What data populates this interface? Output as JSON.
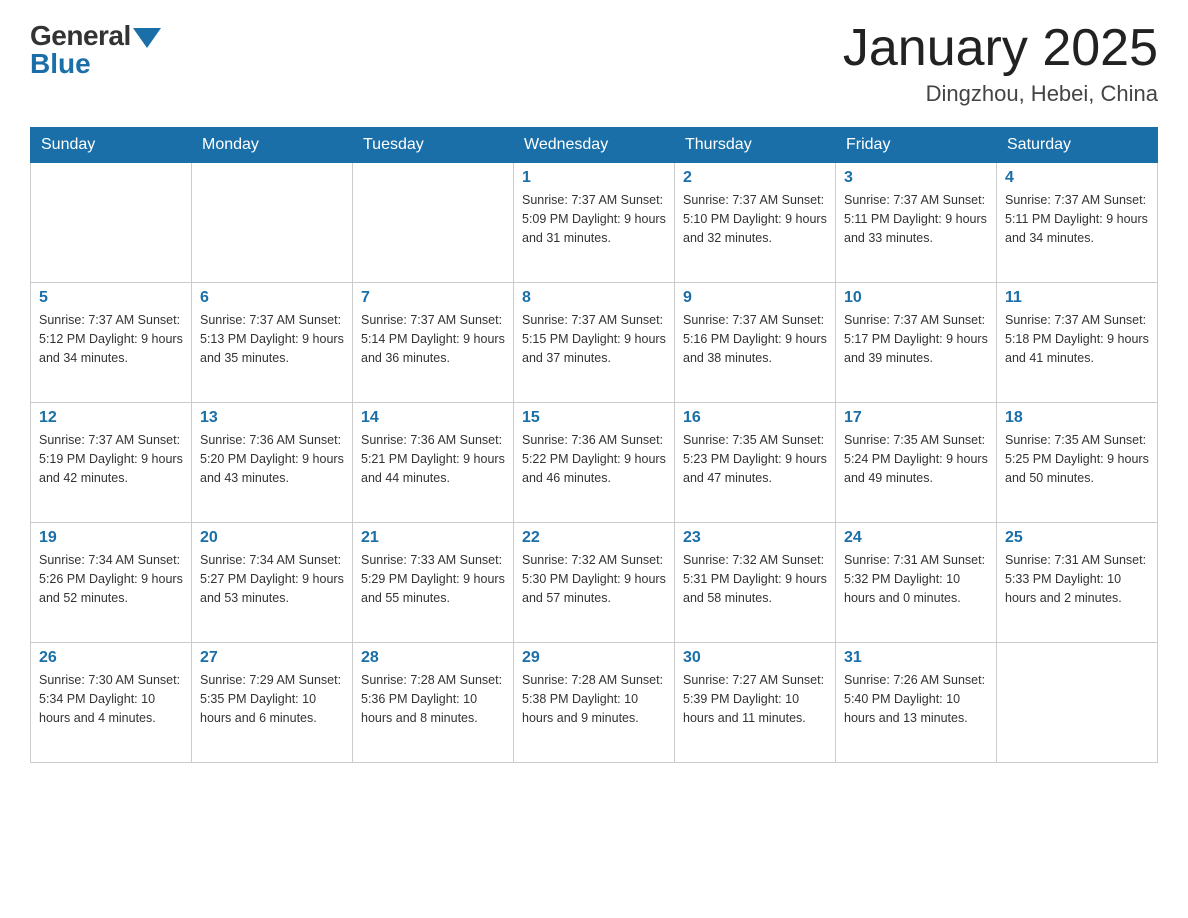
{
  "header": {
    "logo_general": "General",
    "logo_blue": "Blue",
    "month_year": "January 2025",
    "location": "Dingzhou, Hebei, China"
  },
  "days_of_week": [
    "Sunday",
    "Monday",
    "Tuesday",
    "Wednesday",
    "Thursday",
    "Friday",
    "Saturday"
  ],
  "weeks": [
    [
      {
        "day": "",
        "info": ""
      },
      {
        "day": "",
        "info": ""
      },
      {
        "day": "",
        "info": ""
      },
      {
        "day": "1",
        "info": "Sunrise: 7:37 AM\nSunset: 5:09 PM\nDaylight: 9 hours\nand 31 minutes."
      },
      {
        "day": "2",
        "info": "Sunrise: 7:37 AM\nSunset: 5:10 PM\nDaylight: 9 hours\nand 32 minutes."
      },
      {
        "day": "3",
        "info": "Sunrise: 7:37 AM\nSunset: 5:11 PM\nDaylight: 9 hours\nand 33 minutes."
      },
      {
        "day": "4",
        "info": "Sunrise: 7:37 AM\nSunset: 5:11 PM\nDaylight: 9 hours\nand 34 minutes."
      }
    ],
    [
      {
        "day": "5",
        "info": "Sunrise: 7:37 AM\nSunset: 5:12 PM\nDaylight: 9 hours\nand 34 minutes."
      },
      {
        "day": "6",
        "info": "Sunrise: 7:37 AM\nSunset: 5:13 PM\nDaylight: 9 hours\nand 35 minutes."
      },
      {
        "day": "7",
        "info": "Sunrise: 7:37 AM\nSunset: 5:14 PM\nDaylight: 9 hours\nand 36 minutes."
      },
      {
        "day": "8",
        "info": "Sunrise: 7:37 AM\nSunset: 5:15 PM\nDaylight: 9 hours\nand 37 minutes."
      },
      {
        "day": "9",
        "info": "Sunrise: 7:37 AM\nSunset: 5:16 PM\nDaylight: 9 hours\nand 38 minutes."
      },
      {
        "day": "10",
        "info": "Sunrise: 7:37 AM\nSunset: 5:17 PM\nDaylight: 9 hours\nand 39 minutes."
      },
      {
        "day": "11",
        "info": "Sunrise: 7:37 AM\nSunset: 5:18 PM\nDaylight: 9 hours\nand 41 minutes."
      }
    ],
    [
      {
        "day": "12",
        "info": "Sunrise: 7:37 AM\nSunset: 5:19 PM\nDaylight: 9 hours\nand 42 minutes."
      },
      {
        "day": "13",
        "info": "Sunrise: 7:36 AM\nSunset: 5:20 PM\nDaylight: 9 hours\nand 43 minutes."
      },
      {
        "day": "14",
        "info": "Sunrise: 7:36 AM\nSunset: 5:21 PM\nDaylight: 9 hours\nand 44 minutes."
      },
      {
        "day": "15",
        "info": "Sunrise: 7:36 AM\nSunset: 5:22 PM\nDaylight: 9 hours\nand 46 minutes."
      },
      {
        "day": "16",
        "info": "Sunrise: 7:35 AM\nSunset: 5:23 PM\nDaylight: 9 hours\nand 47 minutes."
      },
      {
        "day": "17",
        "info": "Sunrise: 7:35 AM\nSunset: 5:24 PM\nDaylight: 9 hours\nand 49 minutes."
      },
      {
        "day": "18",
        "info": "Sunrise: 7:35 AM\nSunset: 5:25 PM\nDaylight: 9 hours\nand 50 minutes."
      }
    ],
    [
      {
        "day": "19",
        "info": "Sunrise: 7:34 AM\nSunset: 5:26 PM\nDaylight: 9 hours\nand 52 minutes."
      },
      {
        "day": "20",
        "info": "Sunrise: 7:34 AM\nSunset: 5:27 PM\nDaylight: 9 hours\nand 53 minutes."
      },
      {
        "day": "21",
        "info": "Sunrise: 7:33 AM\nSunset: 5:29 PM\nDaylight: 9 hours\nand 55 minutes."
      },
      {
        "day": "22",
        "info": "Sunrise: 7:32 AM\nSunset: 5:30 PM\nDaylight: 9 hours\nand 57 minutes."
      },
      {
        "day": "23",
        "info": "Sunrise: 7:32 AM\nSunset: 5:31 PM\nDaylight: 9 hours\nand 58 minutes."
      },
      {
        "day": "24",
        "info": "Sunrise: 7:31 AM\nSunset: 5:32 PM\nDaylight: 10 hours\nand 0 minutes."
      },
      {
        "day": "25",
        "info": "Sunrise: 7:31 AM\nSunset: 5:33 PM\nDaylight: 10 hours\nand 2 minutes."
      }
    ],
    [
      {
        "day": "26",
        "info": "Sunrise: 7:30 AM\nSunset: 5:34 PM\nDaylight: 10 hours\nand 4 minutes."
      },
      {
        "day": "27",
        "info": "Sunrise: 7:29 AM\nSunset: 5:35 PM\nDaylight: 10 hours\nand 6 minutes."
      },
      {
        "day": "28",
        "info": "Sunrise: 7:28 AM\nSunset: 5:36 PM\nDaylight: 10 hours\nand 8 minutes."
      },
      {
        "day": "29",
        "info": "Sunrise: 7:28 AM\nSunset: 5:38 PM\nDaylight: 10 hours\nand 9 minutes."
      },
      {
        "day": "30",
        "info": "Sunrise: 7:27 AM\nSunset: 5:39 PM\nDaylight: 10 hours\nand 11 minutes."
      },
      {
        "day": "31",
        "info": "Sunrise: 7:26 AM\nSunset: 5:40 PM\nDaylight: 10 hours\nand 13 minutes."
      },
      {
        "day": "",
        "info": ""
      }
    ]
  ]
}
